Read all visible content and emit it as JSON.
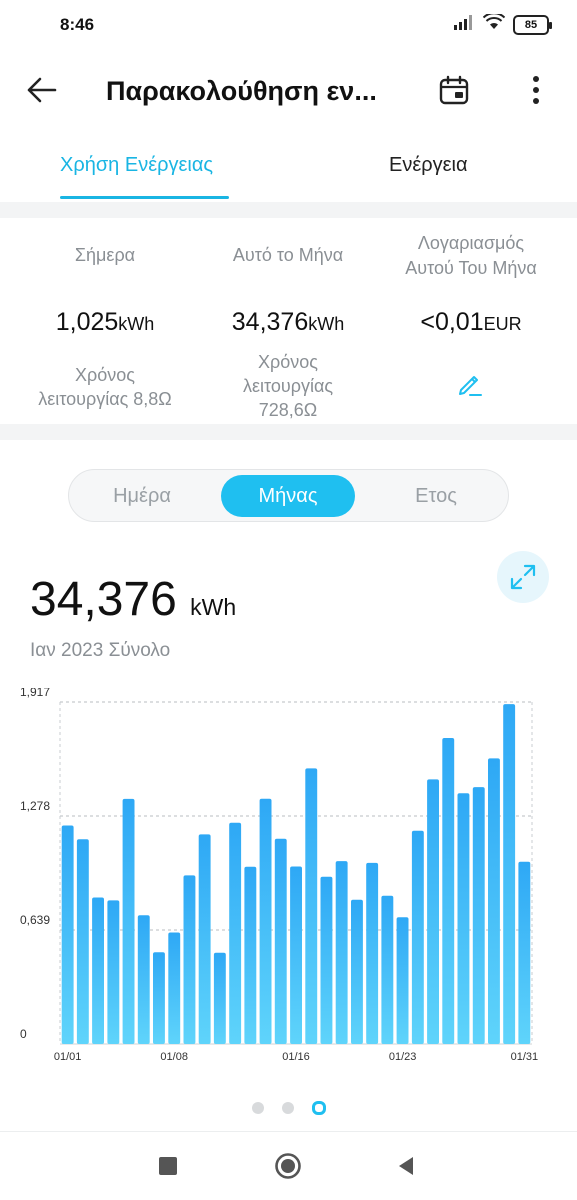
{
  "status": {
    "time": "8:46",
    "battery": "85"
  },
  "header": {
    "title": "Παρακολούθηση εν...",
    "back_icon": "arrow-left-icon",
    "calendar_icon": "calendar-icon",
    "more_icon": "more-vertical-icon"
  },
  "tabs": [
    {
      "label": "Χρήση Ενέργειας",
      "active": true
    },
    {
      "label": "Ενέργεια",
      "active": false
    }
  ],
  "stats": {
    "today": {
      "label": "Σήμερα",
      "value": "1,025",
      "unit": "kWh",
      "runtime_line1": "Χρόνος",
      "runtime_line2": "λειτουργίας 8,8Ω"
    },
    "month": {
      "label": "Αυτό το Μήνα",
      "value": "34,376",
      "unit": "kWh",
      "runtime_line1": "Χρόνος",
      "runtime_line2": "λειτουργίας",
      "runtime_line3": "728,6Ω"
    },
    "bill": {
      "label_line1": "Λογαριασμός",
      "label_line2": "Αυτού Του Μήνα",
      "value": "<0,01",
      "unit": "EUR"
    }
  },
  "period": {
    "day": "Ημέρα",
    "month": "Μήνας",
    "year": "Ετος",
    "selected": "Μήνας"
  },
  "summary": {
    "value": "34,376",
    "unit": "kWh",
    "subtitle": "Ιαν 2023 Σύνολο"
  },
  "colors": {
    "accent": "#1fbff0",
    "bar_top": "#2ea8f5",
    "bar_bottom": "#5fd4fb"
  },
  "pager": {
    "count": 3,
    "active": 2
  },
  "chart_data": {
    "type": "bar",
    "categories": [
      "01/01",
      "01/02",
      "01/03",
      "01/04",
      "01/05",
      "01/06",
      "01/07",
      "01/08",
      "01/09",
      "01/10",
      "01/11",
      "01/12",
      "01/13",
      "01/14",
      "01/15",
      "01/16",
      "01/17",
      "01/18",
      "01/19",
      "01/20",
      "01/21",
      "01/22",
      "01/23",
      "01/24",
      "01/25",
      "01/26",
      "01/27",
      "01/28",
      "01/29",
      "01/30",
      "01/31"
    ],
    "x_tick_labels": [
      "01/01",
      "01/08",
      "01/16",
      "01/23",
      "01/31"
    ],
    "x_tick_indices": [
      0,
      7,
      15,
      22,
      30
    ],
    "values": [
      1.225,
      1.148,
      0.821,
      0.805,
      1.374,
      0.722,
      0.514,
      0.625,
      0.945,
      1.175,
      0.512,
      1.24,
      0.993,
      1.375,
      1.15,
      0.995,
      1.545,
      0.938,
      1.025,
      0.808,
      1.015,
      0.831,
      0.711,
      1.195,
      1.483,
      1.715,
      1.405,
      1.44,
      1.601,
      1.905,
      1.022
    ],
    "y_ticks": [
      "0",
      "0,639",
      "1,278",
      "1,917"
    ],
    "ylim": [
      0,
      1.917
    ],
    "grid": true
  }
}
